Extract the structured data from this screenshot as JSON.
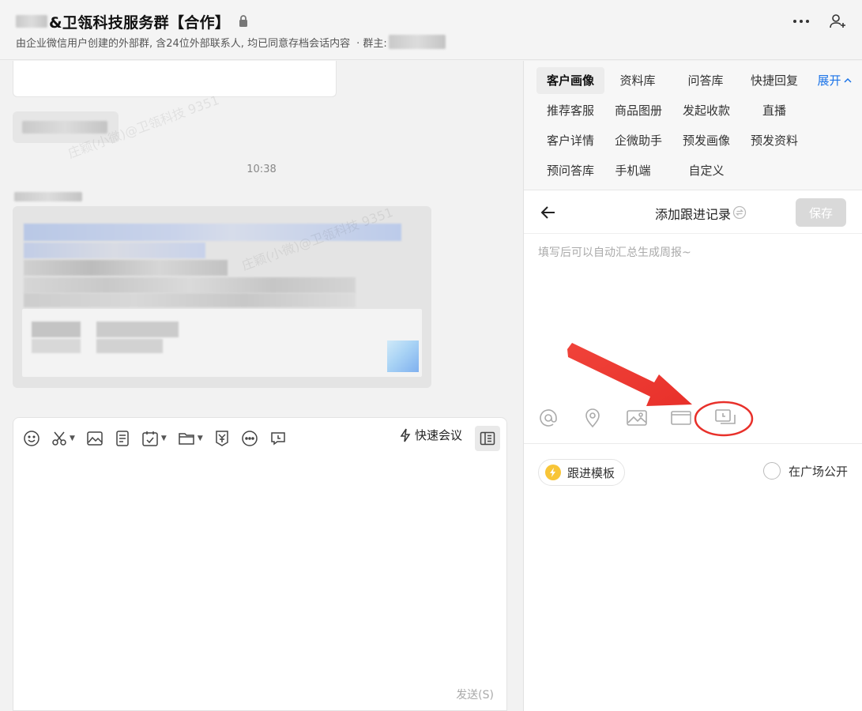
{
  "header": {
    "title": "&卫瓴科技服务群【合作】",
    "subtitle": "由企业微信用户创建的外部群, 含24位外部联系人, 均已同意存档会话内容",
    "owner_label": "· 群主: "
  },
  "chat": {
    "time": "10:38",
    "watermark": "庄颖(小微)@卫瓴科技 9351"
  },
  "composer": {
    "quick_meeting_label": "快速会议",
    "send_label": "发送(S)",
    "tools": [
      "emoji-icon",
      "scissors-icon",
      "image-icon",
      "document-icon",
      "calendar-check-icon",
      "folder-icon",
      "red-packet-icon",
      "more-icon",
      "chat-record-icon"
    ]
  },
  "panel": {
    "tabs": [
      {
        "label": "客户画像",
        "active": true
      },
      {
        "label": "资料库"
      },
      {
        "label": "问答库"
      },
      {
        "label": "快捷回复"
      },
      {
        "label": "展开"
      },
      {
        "label": "推荐客服"
      },
      {
        "label": "商品图册"
      },
      {
        "label": "发起收款"
      },
      {
        "label": "直播"
      },
      {
        "label": "客户详情"
      },
      {
        "label": "企微助手"
      },
      {
        "label": "预发画像"
      },
      {
        "label": "预发资料"
      },
      {
        "label": "预问答库"
      },
      {
        "label": "手机端"
      },
      {
        "label": "自定义"
      }
    ],
    "title": "添加跟进记录",
    "save_label": "保存",
    "placeholder": "填写后可以自动汇总生成周报~",
    "template_label": "跟进模板",
    "public_label": "在广场公开",
    "editor_tools": [
      "at-icon",
      "location-icon",
      "image-icon",
      "card-icon",
      "chat-record-icon"
    ]
  },
  "colors": {
    "accent_blue": "#1a73e8",
    "annotation_red": "#e8302a",
    "template_badge": "#f8c537"
  }
}
